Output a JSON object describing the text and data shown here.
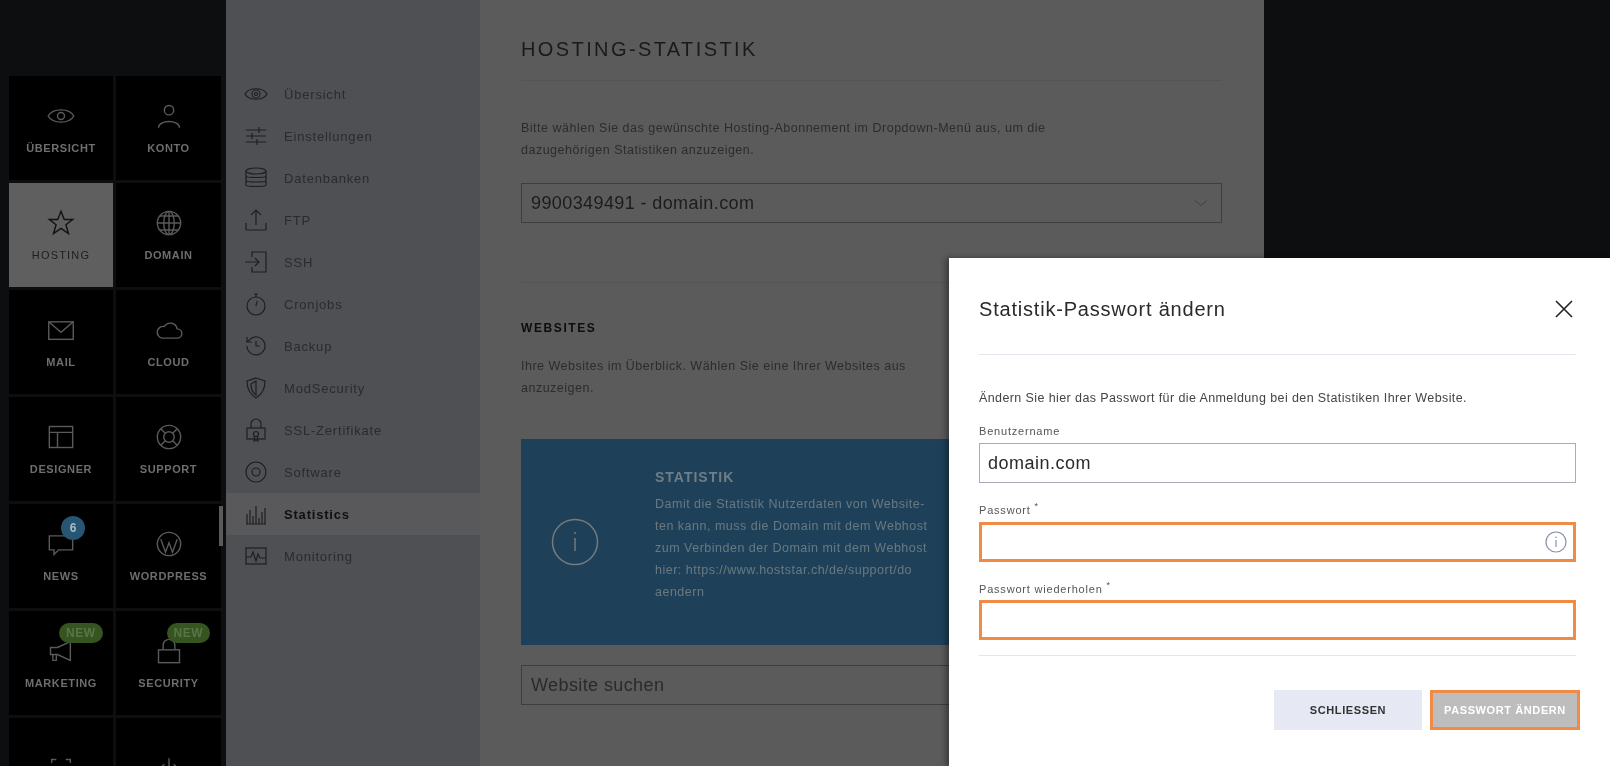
{
  "nav": {
    "items": [
      {
        "label": "ÜBERSICHT",
        "selected": false
      },
      {
        "label": "KONTO",
        "selected": false
      },
      {
        "label": "HOSTING",
        "selected": true
      },
      {
        "label": "DOMAIN",
        "selected": false
      },
      {
        "label": "MAIL",
        "selected": false
      },
      {
        "label": "CLOUD",
        "selected": false
      },
      {
        "label": "DESIGNER",
        "selected": false
      },
      {
        "label": "SUPPORT",
        "selected": false
      },
      {
        "label": "NEWS",
        "selected": false,
        "badge": {
          "kind": "count",
          "text": "6"
        }
      },
      {
        "label": "WORDPRESS",
        "selected": false
      },
      {
        "label": "MARKETING",
        "selected": false,
        "badge": {
          "kind": "new",
          "text": "NEW"
        }
      },
      {
        "label": "SECURITY",
        "selected": false,
        "badge": {
          "kind": "new",
          "text": "NEW"
        }
      },
      {
        "selected": false
      },
      {
        "selected": false
      }
    ]
  },
  "sidebar": {
    "items": [
      {
        "label": "Übersicht",
        "selected": false
      },
      {
        "label": "Einstellungen",
        "selected": false
      },
      {
        "label": "Datenbanken",
        "selected": false
      },
      {
        "label": "FTP",
        "selected": false
      },
      {
        "label": "SSH",
        "selected": false
      },
      {
        "label": "Cronjobs",
        "selected": false
      },
      {
        "label": "Backup",
        "selected": false
      },
      {
        "label": "ModSecurity",
        "selected": false
      },
      {
        "label": "SSL-Zertifikate",
        "selected": false
      },
      {
        "label": "Software",
        "selected": false
      },
      {
        "label": "Statistics",
        "selected": true
      },
      {
        "label": "Monitoring",
        "selected": false
      }
    ]
  },
  "main": {
    "title": "HOSTING-STATISTIK",
    "intro_lines": [
      "Bitte wählen Sie das gewünschte Hosting-Abonnement im Dropdown-Menü aus, um die",
      "dazugehörigen Statistiken anzuzeigen."
    ],
    "subscription_select": {
      "value": "9900349491 - domain.com"
    },
    "websites_heading": "WEBSITES",
    "websites_lines": [
      "Ihre Websites im Überblick. Wählen Sie eine Ihrer Websites aus",
      "anzuzeigen."
    ],
    "notice": {
      "title": "STATISTIK",
      "lines": [
        "Damit die Statistik Nutzerdaten von Website-",
        "ten kann, muss die Domain mit dem Webhost",
        "zum Verbinden der Domain mit dem Webhost",
        "hier: https://www.hoststar.ch/de/support/do",
        "aendern"
      ]
    },
    "search": {
      "placeholder": "Website suchen"
    }
  },
  "dialog": {
    "title": "Statistik-Passwort ändern",
    "description": "Ändern Sie hier das Passwort für die Anmeldung bei den Statistiken Ihrer Website.",
    "fields": [
      {
        "label": "Benutzername",
        "value": "domain.com",
        "invalid": false
      },
      {
        "label": "Passwort $^{*}$",
        "invalid": true,
        "info": true
      },
      {
        "label": "Passwort wiederholen $^{*}$",
        "invalid": true
      }
    ],
    "buttons": [
      {
        "label": "SCHLIESSEN",
        "kind": "secondary",
        "focused": false
      },
      {
        "label": "PASSWORT ÄNDERN",
        "kind": "primary",
        "focused": true
      }
    ]
  }
}
